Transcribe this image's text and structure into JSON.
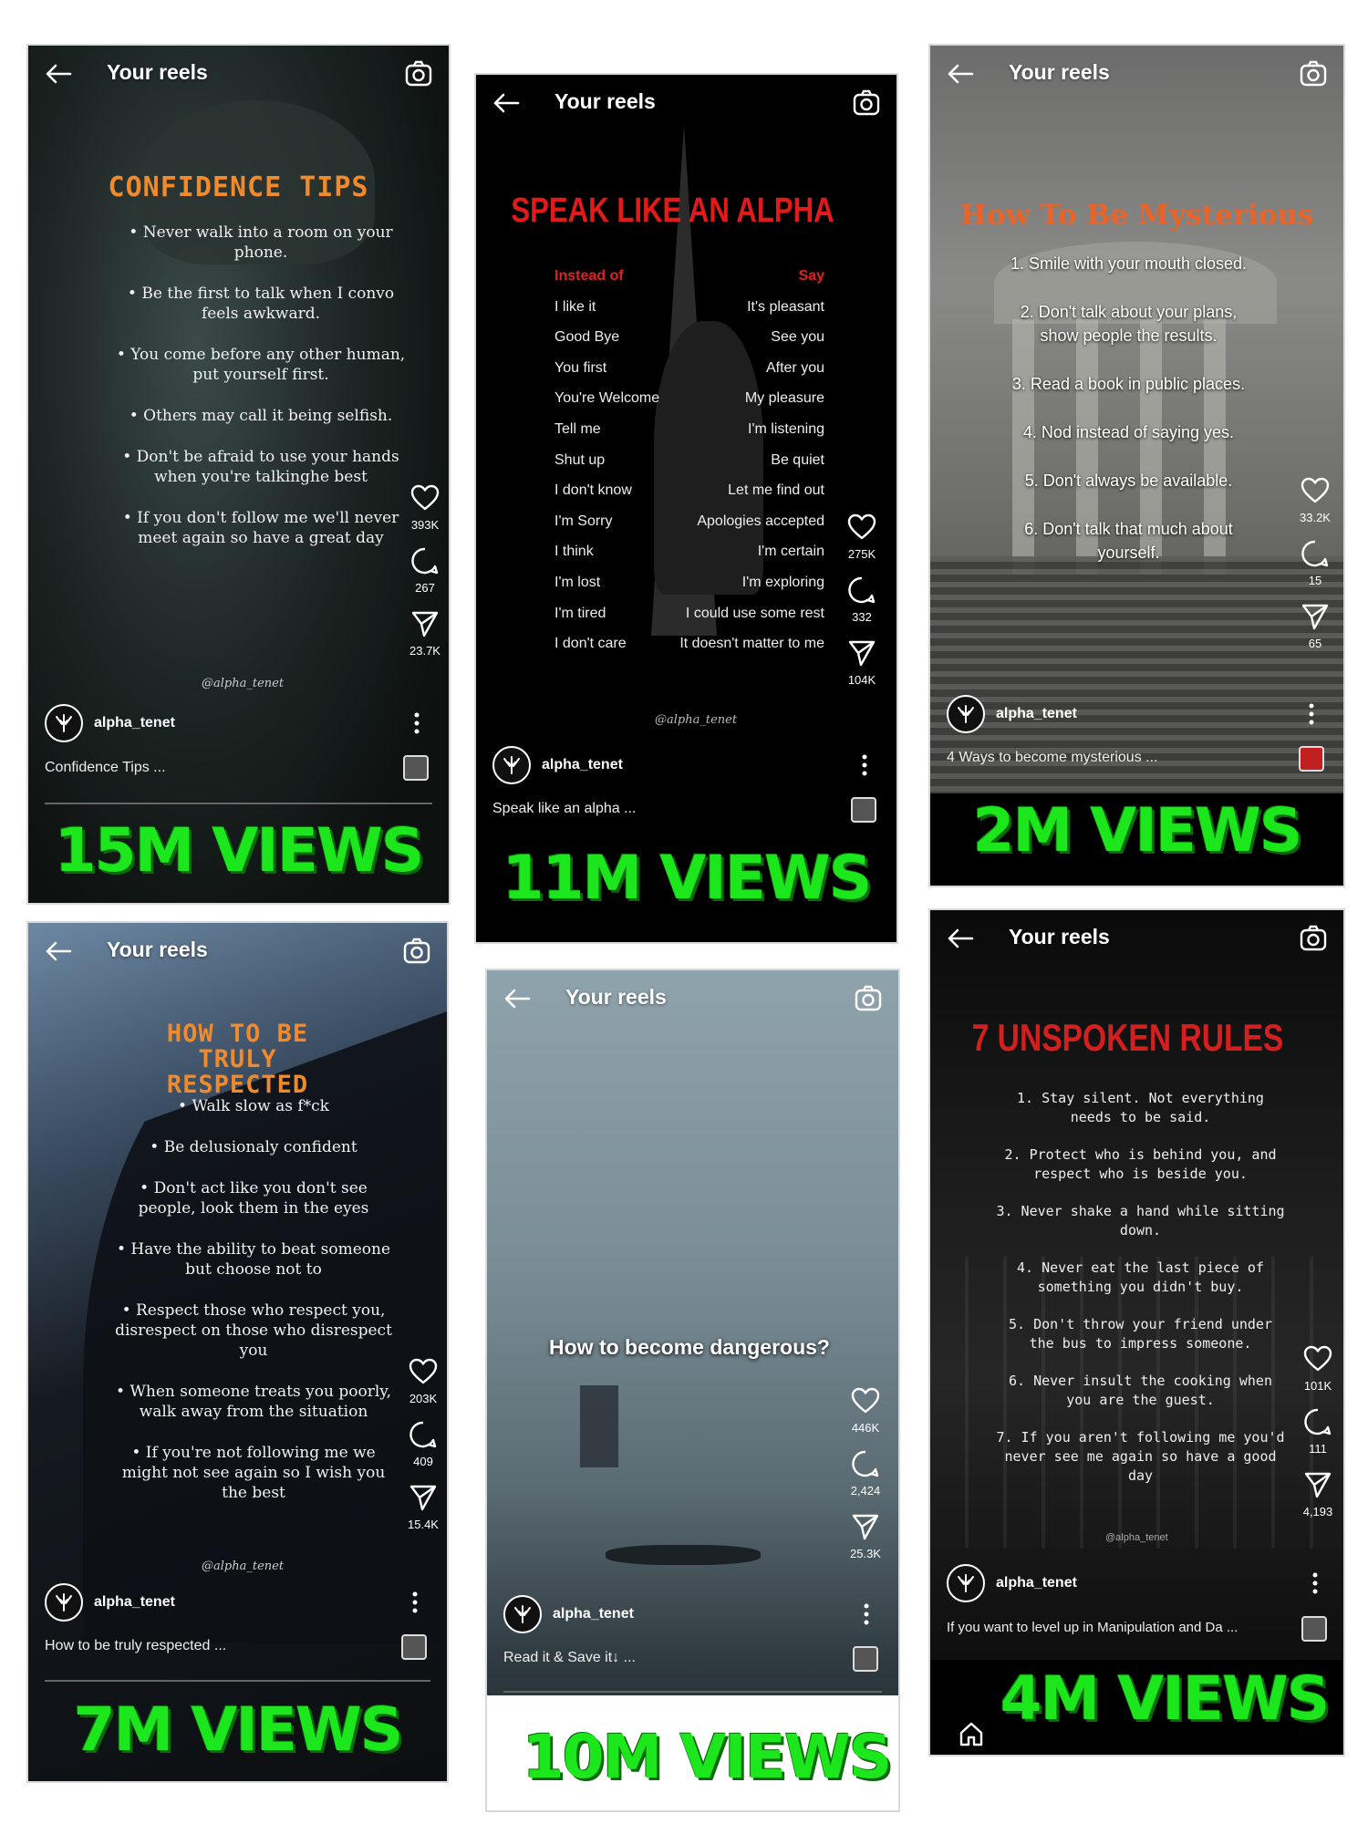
{
  "reels": [
    {
      "header": "Your reels",
      "title": "CONFIDENCE TIPS",
      "tips": [
        "• Never walk into a room on your phone.",
        "• Be the first to talk when I convo feels awkward.",
        "• You come before any other human, put yourself first.",
        "• Others may call it being selfish.",
        "• Don't be afraid to use your hands when you're talkinghe best",
        "• If you don't follow me we'll never meet again so have a great day"
      ],
      "watermark": "@alpha_tenet",
      "likes": "393K",
      "comments": "267",
      "shares": "23.7K",
      "username": "alpha_tenet",
      "caption": "Confidence Tips ...",
      "views": "15M VIEWS"
    },
    {
      "header": "Your reels",
      "title": "SPEAK LIKE AN ALPHA",
      "col_left_header": "Instead of",
      "col_right_header": "Say",
      "rows": [
        [
          "I like it",
          "It's pleasant"
        ],
        [
          "Good Bye",
          "See you"
        ],
        [
          "You first",
          "After you"
        ],
        [
          "You're Welcome",
          "My pleasure"
        ],
        [
          "Tell me",
          "I'm listening"
        ],
        [
          "Shut up",
          "Be quiet"
        ],
        [
          "I don't know",
          "Let me find out"
        ],
        [
          "I'm Sorry",
          "Apologies accepted"
        ],
        [
          "I think",
          "I'm certain"
        ],
        [
          "I'm lost",
          "I'm exploring"
        ],
        [
          "I'm tired",
          "I could use some rest"
        ],
        [
          "I don't care",
          "It doesn't matter to me"
        ]
      ],
      "watermark": "@alpha_tenet",
      "likes": "275K",
      "comments": "332",
      "shares": "104K",
      "username": "alpha_tenet",
      "caption": "Speak like an alpha ...",
      "views": "11M VIEWS"
    },
    {
      "header": "Your reels",
      "title": "How To Be Mysterious",
      "tips": [
        "1. Smile with your mouth closed.",
        "2. Don't talk about your plans, show people the results.",
        "3. Read a book in public places.",
        "4. Nod instead of saying yes.",
        "5. Don't always be available.",
        "6. Don't talk that much about yourself."
      ],
      "likes": "33.2K",
      "comments": "15",
      "shares": "65",
      "username": "alpha_tenet",
      "caption": "4 Ways to become mysterious ...",
      "views": "2M VIEWS"
    },
    {
      "header": "Your reels",
      "title": "HOW TO BE TRULY RESPECTED",
      "tips": [
        "• Walk slow as f*ck",
        "• Be delusionaly confident",
        "• Don't act like you don't see people, look them in the eyes",
        "• Have the ability to beat someone but choose not to",
        "• Respect those who respect you, disrespect on those who disrespect you",
        "• When someone treats you poorly, walk away from the situation",
        "• If you're not following me we might not see again so I wish you the best"
      ],
      "watermark": "@alpha_tenet",
      "likes": "203K",
      "comments": "409",
      "shares": "15.4K",
      "username": "alpha_tenet",
      "caption": "How to be truly respected ...",
      "views": "7M VIEWS"
    },
    {
      "header": "Your reels",
      "title": "How to become dangerous?",
      "likes": "446K",
      "comments": "2,424",
      "shares": "25.3K",
      "username": "alpha_tenet",
      "caption": "Read it & Save it↓ ...",
      "views": "10M VIEWS"
    },
    {
      "header": "Your reels",
      "title": "7 UNSPOKEN RULES",
      "tips": [
        "1. Stay silent. Not everything needs to be said.",
        "2. Protect who is behind you, and respect who is beside you.",
        "3. Never shake a hand while sitting down.",
        "4. Never eat the last piece of something you didn't buy.",
        "5. Don't throw your friend under the bus to impress someone.",
        "6. Never insult the cooking when you are the guest.",
        "7. If you aren't following me you'd never see me again so have a good day"
      ],
      "watermark": "@alpha_tenet",
      "likes": "101K",
      "comments": "111",
      "shares": "4,193",
      "username": "alpha_tenet",
      "caption": "If you want to level up in Manipulation and Da ...",
      "views": "4M VIEWS"
    }
  ],
  "icons": [
    "back-arrow-icon",
    "camera-icon",
    "heart-icon",
    "comment-icon",
    "share-icon",
    "more-icon",
    "avatar-logo-icon",
    "home-icon"
  ],
  "colors": {
    "views_green": "#1ce61c",
    "alpha_red": "#e02020",
    "confidence_orange": "#f08a2a",
    "mysterious_orange": "#e8642a",
    "unspoken_red": "#d41f1f"
  }
}
